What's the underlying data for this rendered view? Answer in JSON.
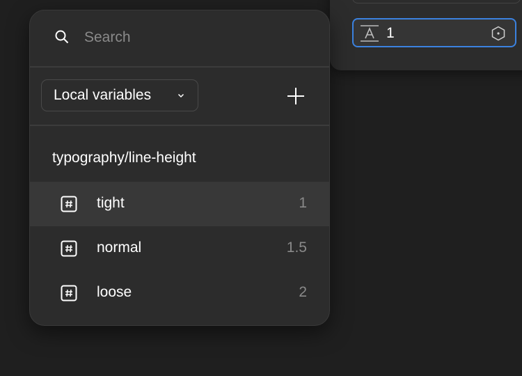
{
  "properties_panel": {
    "line_height_field": {
      "icon": "line-height-icon",
      "value": "1",
      "variable_icon": "variable-hexagon-icon"
    }
  },
  "variables_popover": {
    "search": {
      "icon": "search-icon",
      "placeholder": "Search",
      "value": ""
    },
    "library_select": {
      "label": "Local variables",
      "icon": "chevron-down-icon"
    },
    "add_button": {
      "icon": "plus-icon"
    },
    "group": {
      "title": "typography/line-height",
      "variables": [
        {
          "icon": "number-hash-icon",
          "name": "tight",
          "value": "1",
          "selected": true
        },
        {
          "icon": "number-hash-icon",
          "name": "normal",
          "value": "1.5",
          "selected": false
        },
        {
          "icon": "number-hash-icon",
          "name": "loose",
          "value": "2",
          "selected": false
        }
      ]
    }
  }
}
